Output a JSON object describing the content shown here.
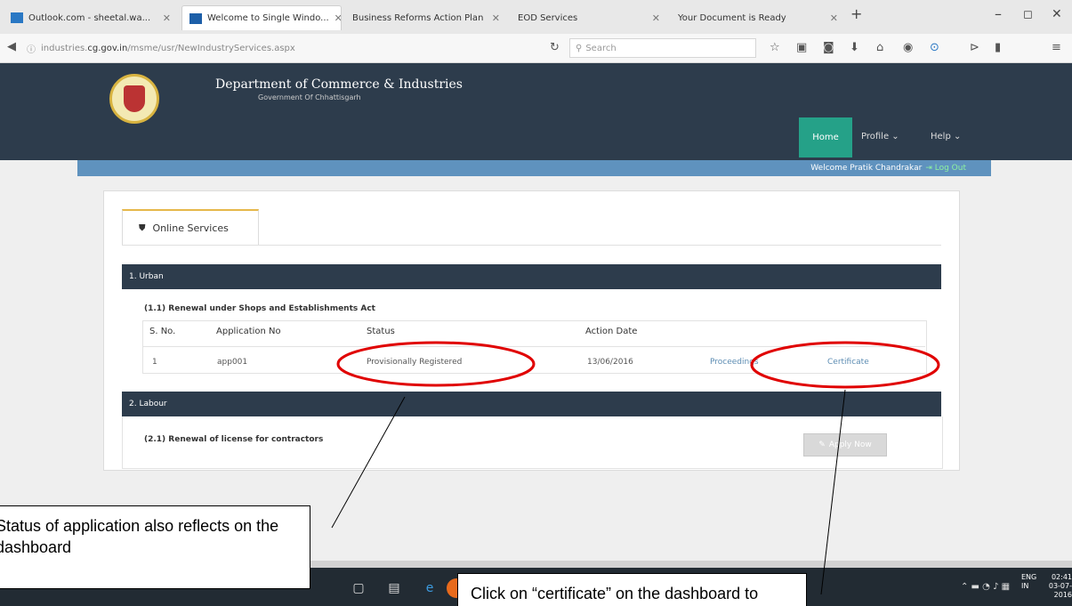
{
  "browser": {
    "tabs": [
      {
        "label": "Outlook.com - sheetal.wa..."
      },
      {
        "label": "Welcome to Single Windo..."
      },
      {
        "label": "Business Reforms Action Plan"
      },
      {
        "label": "EOD Services"
      },
      {
        "label": "Your Document is Ready"
      }
    ],
    "url_prefix": "industries.",
    "url_domain": "cg.gov.in",
    "url_path": "/msme/usr/NewIndustryServices.aspx",
    "search_placeholder": "Search"
  },
  "site": {
    "title": "Department of Commerce & Industries",
    "subtitle": "Government Of Chhattisgarh",
    "nav": {
      "home": "Home",
      "profile": "Profile",
      "help": "Help"
    },
    "welcome_text": "Welcome Pratik Chandrakar",
    "logout": "Log Out"
  },
  "content": {
    "tab_label": "Online Services",
    "sections": [
      {
        "title": "1. Urban",
        "subtitle": "(1.1) Renewal under Shops and Establishments Act"
      },
      {
        "title": "2. Labour",
        "subtitle": "(2.1) Renewal of license for contractors"
      }
    ],
    "table": {
      "headers": [
        "S. No.",
        "Application No",
        "Status",
        "Action Date"
      ],
      "row": {
        "sno": "1",
        "app_no": "app001",
        "status": "Provisionally Registered",
        "date": "13/06/2016",
        "proceedings": "Proceedings",
        "certificate": "Certificate"
      }
    },
    "apply_now": "Apply Now"
  },
  "annotations": {
    "left": "Status of application also reflects on the dashboard",
    "right": "Click on “certificate” on the dashboard to download"
  },
  "taskbar": {
    "lang": "ENG",
    "region": "IN",
    "time": "02:41",
    "date": "03-07-2016"
  },
  "colors": {
    "header_bg": "#2d3c4c",
    "home_active": "#25a188",
    "welcome_bar": "#5f92be",
    "tab_accent": "#e6b84b",
    "annotation_ellipse": "#e00000"
  }
}
